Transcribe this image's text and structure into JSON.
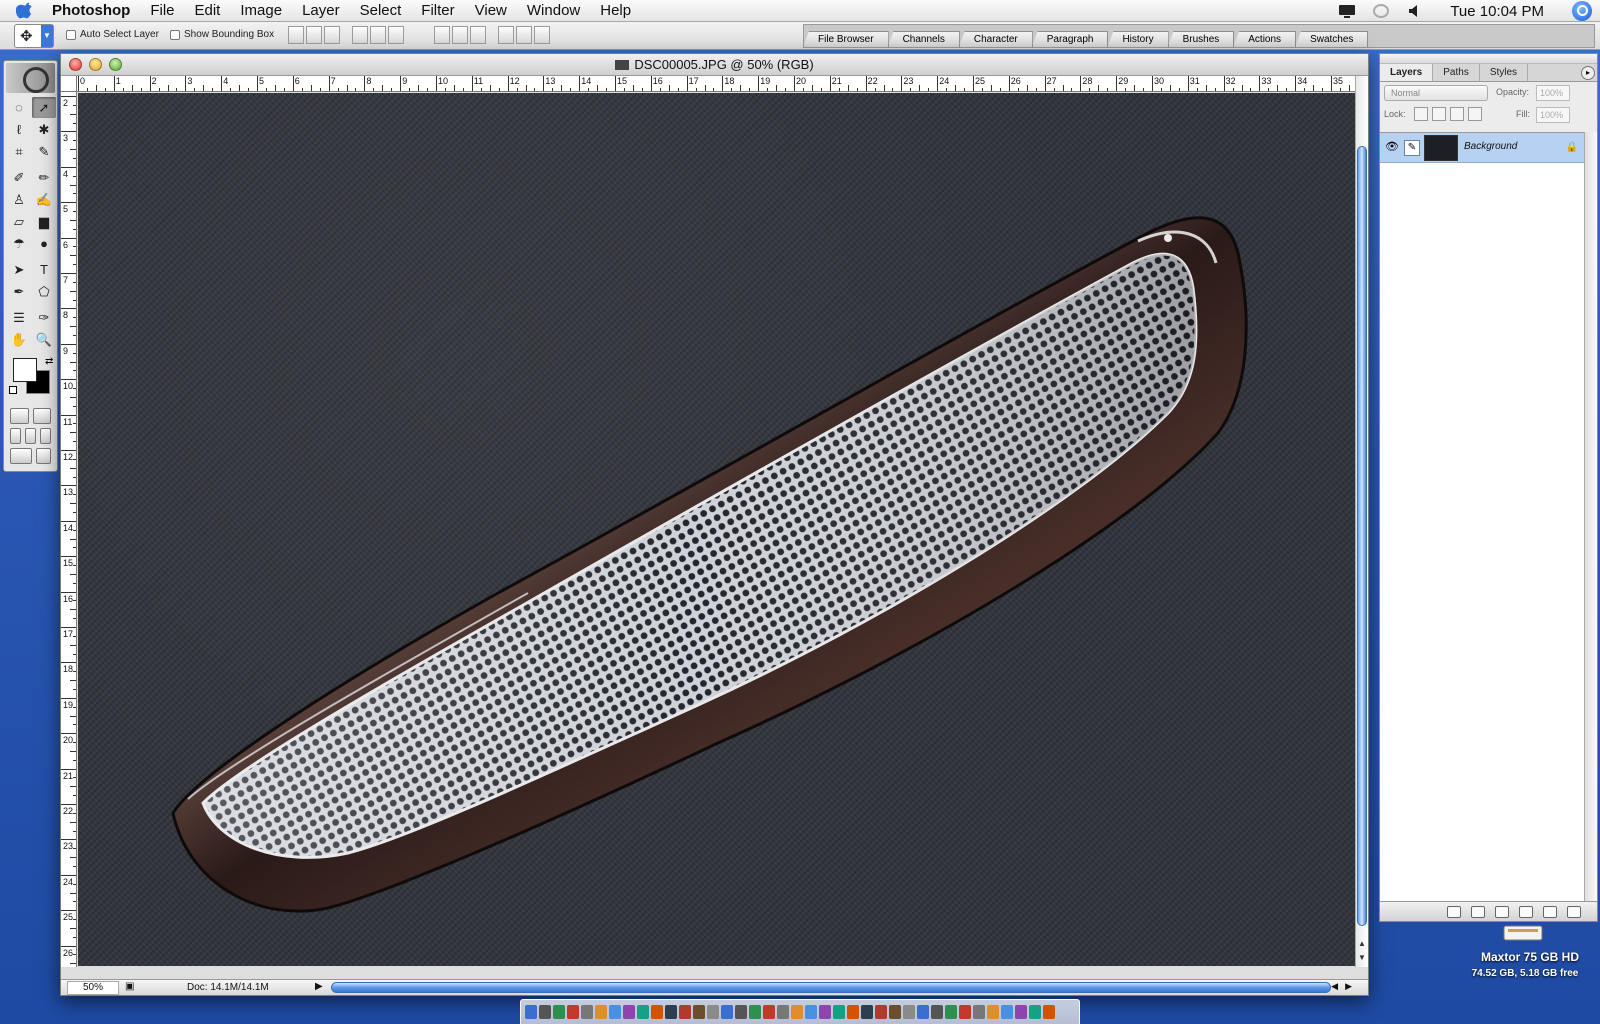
{
  "menubar": {
    "app_name": "Photoshop",
    "menus": [
      "File",
      "Edit",
      "Image",
      "Layer",
      "Select",
      "Filter",
      "View",
      "Window",
      "Help"
    ],
    "clock": "Tue 10:04 PM",
    "status_icons": [
      "display-icon",
      "sync-icon",
      "volume-icon",
      "spotlight-icon"
    ]
  },
  "options_bar": {
    "auto_select_layer": "Auto Select Layer",
    "show_bounding_box": "Show Bounding Box",
    "auto_select_checked": false,
    "bounding_box_checked": false
  },
  "palette_well": {
    "tabs": [
      "File Browser",
      "Channels",
      "Character",
      "Paragraph",
      "History",
      "Brushes",
      "Actions",
      "Swatches"
    ]
  },
  "toolbox": {
    "tools": [
      {
        "icon": "marquee-icon",
        "glyph": "◌"
      },
      {
        "icon": "move-icon",
        "glyph": "➚",
        "active": true
      },
      {
        "icon": "lasso-icon",
        "glyph": "ℓ"
      },
      {
        "icon": "magic-wand-icon",
        "glyph": "✱"
      },
      {
        "icon": "crop-icon",
        "glyph": "⌗"
      },
      {
        "icon": "slice-icon",
        "glyph": "✎"
      },
      {
        "icon": "healing-brush-icon",
        "glyph": "✐"
      },
      {
        "icon": "brush-icon",
        "glyph": "✏"
      },
      {
        "icon": "clone-stamp-icon",
        "glyph": "♙"
      },
      {
        "icon": "history-brush-icon",
        "glyph": "✍"
      },
      {
        "icon": "eraser-icon",
        "glyph": "▱"
      },
      {
        "icon": "gradient-icon",
        "glyph": "▆"
      },
      {
        "icon": "blur-icon",
        "glyph": "☂"
      },
      {
        "icon": "dodge-icon",
        "glyph": "●"
      },
      {
        "icon": "path-select-icon",
        "glyph": "➤"
      },
      {
        "icon": "type-icon",
        "glyph": "T"
      },
      {
        "icon": "pen-icon",
        "glyph": "✒"
      },
      {
        "icon": "shape-icon",
        "glyph": "⬠"
      },
      {
        "icon": "notes-icon",
        "glyph": "☰"
      },
      {
        "icon": "eyedropper-icon",
        "glyph": "✑"
      },
      {
        "icon": "hand-icon",
        "glyph": "✋"
      },
      {
        "icon": "zoom-icon",
        "glyph": "🔍"
      }
    ]
  },
  "document": {
    "title": "DSC00005.JPG @ 50% (RGB)",
    "zoom": "50%",
    "doc_info": "Doc: 14.1M/14.1M",
    "ruler_h_labels": [
      "0",
      "1",
      "2",
      "3",
      "4",
      "5",
      "6",
      "7",
      "8",
      "9",
      "10",
      "11",
      "12",
      "13",
      "14",
      "15",
      "16",
      "17",
      "18",
      "19",
      "20",
      "21",
      "22",
      "23",
      "24",
      "25",
      "26",
      "27",
      "28",
      "29",
      "30",
      "31",
      "32",
      "33",
      "34",
      "35"
    ],
    "ruler_v_labels": [
      "2",
      "3",
      "4",
      "5",
      "6",
      "7",
      "8",
      "9",
      "10",
      "11",
      "12",
      "13",
      "14",
      "15",
      "16",
      "17",
      "18",
      "19",
      "20",
      "21",
      "22",
      "23",
      "24",
      "25",
      "26"
    ]
  },
  "layers_palette": {
    "tabs": [
      "Layers",
      "Paths",
      "Styles"
    ],
    "blend_mode": "Normal",
    "opacity_label": "Opacity:",
    "opacity_value": "100%",
    "lock_label": "Lock:",
    "fill_label": "Fill:",
    "fill_value": "100%",
    "layers": [
      {
        "name": "Background",
        "visible": true,
        "locked": true
      }
    ]
  },
  "desktop": {
    "drive_name": "Maxtor 75 GB HD",
    "drive_free": "74.52 GB, 5.18 GB free"
  },
  "colors": {
    "foreground": "#ffffff",
    "background": "#000000",
    "selection": "#b7d1f3"
  }
}
